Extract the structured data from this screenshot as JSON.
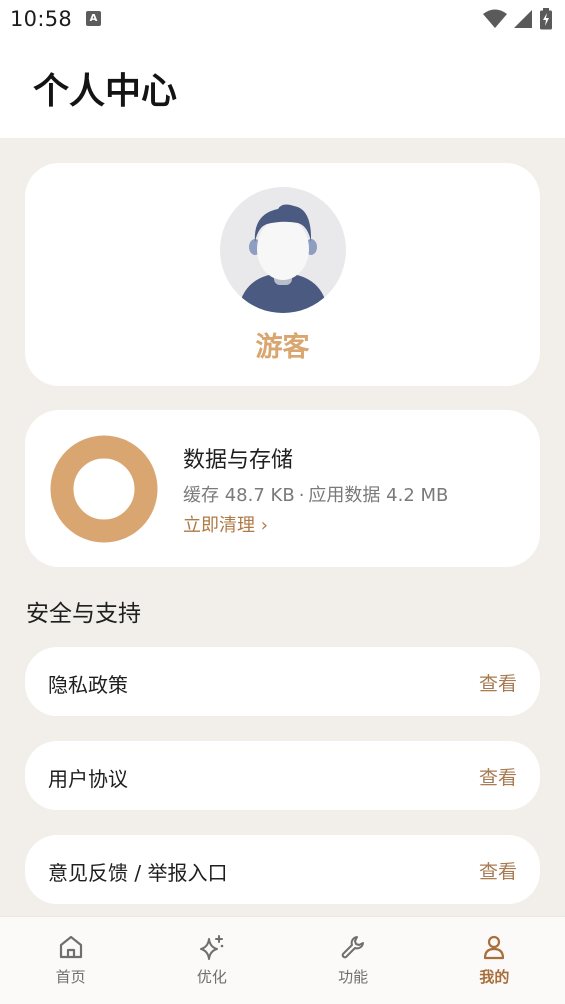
{
  "status": {
    "time": "10:58",
    "notification_glyph": "A"
  },
  "header": {
    "title": "个人中心"
  },
  "profile": {
    "name": "游客"
  },
  "storage": {
    "title": "数据与存储",
    "cache_text": "缓存 48.7 KB",
    "separator": "·",
    "app_data_text": "应用数据 4.2 MB",
    "clean_label": "立即清理 ›"
  },
  "security": {
    "section_title": "安全与支持",
    "items": [
      {
        "label": "隐私政策",
        "action": "查看"
      },
      {
        "label": "用户协议",
        "action": "查看"
      },
      {
        "label": "意见反馈 / 举报入口",
        "action": "查看"
      }
    ]
  },
  "nav": {
    "items": [
      {
        "label": "首页",
        "icon": "home-icon"
      },
      {
        "label": "优化",
        "icon": "sparkle-icon"
      },
      {
        "label": "功能",
        "icon": "wrench-icon"
      },
      {
        "label": "我的",
        "icon": "user-icon"
      }
    ],
    "active_index": 3
  },
  "colors": {
    "accent": "#d9a66f",
    "accent_text": "#a86f3c",
    "background": "#f2efea"
  }
}
